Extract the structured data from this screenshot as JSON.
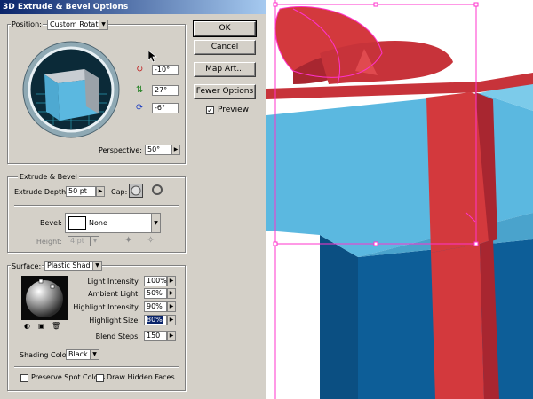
{
  "dialog": {
    "title": "3D Extrude & Bevel Options",
    "buttons": {
      "ok": "OK",
      "cancel": "Cancel",
      "map_art": "Map Art...",
      "fewer_options": "Fewer Options"
    },
    "preview": {
      "label": "Preview",
      "checked": true,
      "check_glyph": "✓"
    }
  },
  "position": {
    "label": "Position:",
    "value": "Custom Rotation",
    "rot_x": "-10°",
    "rot_y": "27°",
    "rot_z": "-6°",
    "perspective_label": "Perspective:",
    "perspective": "50°"
  },
  "extrude": {
    "group_label": "Extrude & Bevel",
    "depth_label": "Extrude Depth:",
    "depth": "50 pt",
    "cap_label": "Cap:",
    "bevel_label": "Bevel:",
    "bevel": "None",
    "height_label": "Height:",
    "height": "4 pt"
  },
  "surface": {
    "label": "Surface:",
    "value": "Plastic Shading",
    "light_intensity_label": "Light Intensity:",
    "light_intensity": "100%",
    "ambient_light_label": "Ambient Light:",
    "ambient_light": "50%",
    "highlight_intensity_label": "Highlight Intensity:",
    "highlight_intensity": "90%",
    "highlight_size_label": "Highlight Size:",
    "highlight_size": "80%",
    "blend_steps_label": "Blend Steps:",
    "blend_steps": "150",
    "shading_color_label": "Shading Color:",
    "shading_color": "Black",
    "preserve_spot_colors": "Preserve Spot Colors",
    "draw_hidden_faces": "Draw Hidden Faces"
  },
  "colors": {
    "box_light": "#5bb8e0",
    "box_dark": "#0d5e98",
    "ribbon": "#d3393d",
    "ribbon_dark": "#a82630",
    "selection": "#ff33cc"
  }
}
